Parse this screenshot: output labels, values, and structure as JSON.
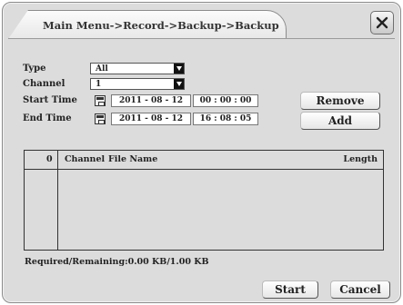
{
  "window": {
    "title": "Main Menu->Record->Backup->Backup",
    "close_icon": "close-x-icon"
  },
  "form": {
    "type_label": "Type",
    "type_value": "All",
    "channel_label": "Channel",
    "channel_value": "1",
    "start_label": "Start Time",
    "start_date": "2011 - 08 - 12",
    "start_time": "00 : 00 : 00",
    "end_label": "End Time",
    "end_date": "2011 - 08 - 12",
    "end_time": "16 : 08 : 05"
  },
  "buttons": {
    "remove": "Remove",
    "add": "Add",
    "start": "Start",
    "cancel": "Cancel"
  },
  "table": {
    "headers": {
      "index": "0",
      "channel": "Channel",
      "file_name": "File Name",
      "length": "Length"
    },
    "rows": []
  },
  "status": {
    "text": "Required/Remaining:0.00 KB/1.00 KB"
  }
}
